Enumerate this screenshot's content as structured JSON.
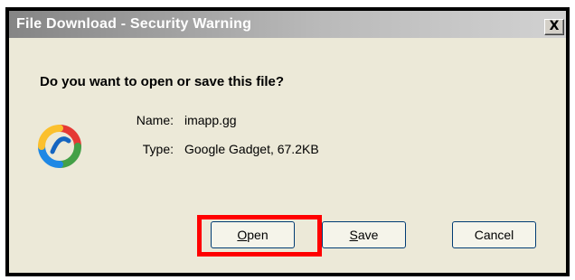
{
  "window": {
    "title": "File Download - Security Warning",
    "close_symbol": "X",
    "close_icon": "close-icon"
  },
  "dialog": {
    "question": "Do you want to open or save this file?",
    "file_icon": "google-gadget-icon",
    "fields": {
      "name_label": "Name:",
      "name_value": "imapp.gg",
      "type_label": "Type:",
      "type_value": "Google Gadget, 67.2KB"
    }
  },
  "buttons": {
    "open": {
      "mnemonic": "O",
      "rest": "pen"
    },
    "save": {
      "mnemonic": "S",
      "rest": "ave"
    },
    "cancel": {
      "label": "Cancel"
    }
  },
  "annotation": {
    "highlight_target": "open-button",
    "color": "#ff0000"
  },
  "colors": {
    "dialog_background": "#ece9d8",
    "title_text": "#ffffff",
    "button_border": "#003c74"
  }
}
